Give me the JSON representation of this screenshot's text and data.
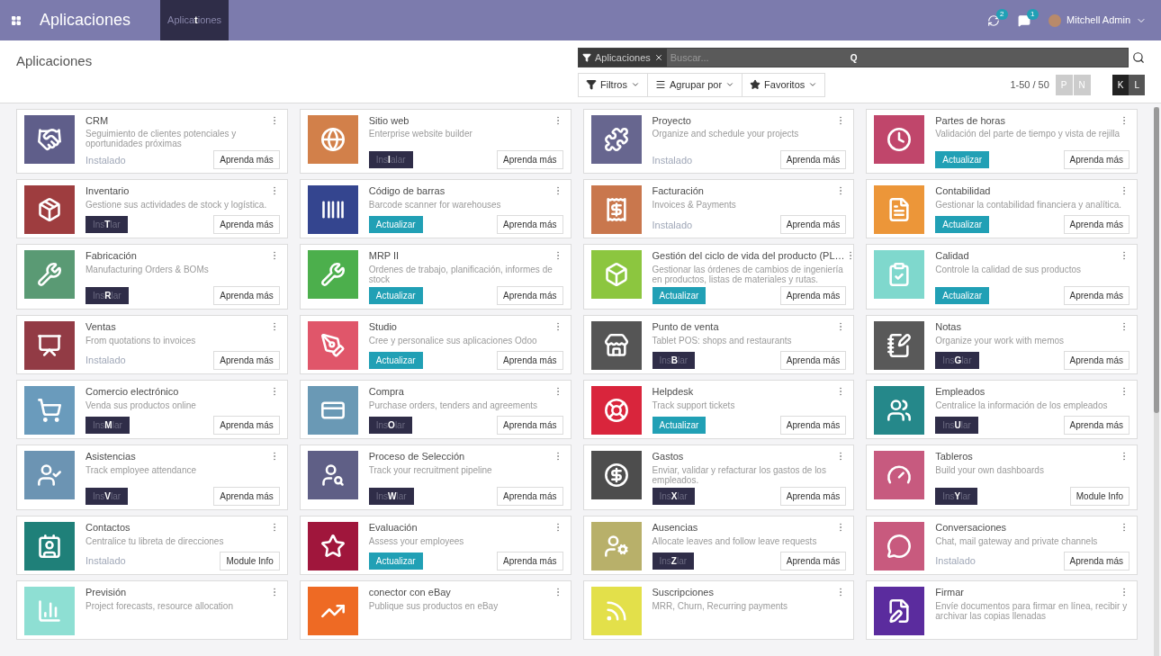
{
  "navbar": {
    "app_title": "Aplicaciones",
    "breadcrumb": {
      "start": "Aplica",
      "hotkey": "t",
      "end": "iones"
    },
    "activity_count": "2",
    "message_count": "1",
    "user": "Mitchell Admin"
  },
  "control_panel": {
    "title": "Aplicaciones",
    "search": {
      "facet": "Aplicaciones",
      "placeholder": "Buscar...",
      "hotkey": "Q"
    },
    "filters": [
      "Filtros",
      "Agrupar por",
      "Favoritos"
    ],
    "pager": "1-50 / 50",
    "pager_buttons": [
      "P",
      "N"
    ],
    "view_buttons": [
      {
        "label": "K",
        "selected": true
      },
      {
        "label": "L",
        "selected": false
      }
    ]
  },
  "apps": [
    {
      "name": "CRM",
      "summary": "Seguimiento de clientes potenciales y oportunidades próximas",
      "color": "#5f5e8a",
      "status": {
        "kind": "installed",
        "text": "Instalado"
      },
      "info": "Aprenda más"
    },
    {
      "name": "Sitio web",
      "summary": "Enterprise website builder",
      "color": "#d2804a",
      "status": {
        "kind": "install",
        "start": "Ins",
        "hotkey": "I",
        "end": "alar"
      },
      "info": "Aprenda más"
    },
    {
      "name": "Proyecto",
      "summary": "Organize and schedule your projects",
      "color": "#67668f",
      "status": {
        "kind": "installed",
        "text": "Instalado"
      },
      "info": "Aprenda más"
    },
    {
      "name": "Partes de horas",
      "summary": "Validación del parte de tiempo y vista de rejilla",
      "color": "#c0466b",
      "status": {
        "kind": "upgrade",
        "text": "Actualizar"
      },
      "info": "Aprenda más"
    },
    {
      "name": "Inventario",
      "summary": "Gestione sus actividades de stock y logística.",
      "color": "#9e3d3f",
      "status": {
        "kind": "install",
        "start": "Ins",
        "hotkey": "T",
        "end": "lar"
      },
      "info": "Aprenda más"
    },
    {
      "name": "Código de barras",
      "summary": "Barcode scanner for warehouses",
      "color": "#34458f",
      "status": {
        "kind": "upgrade",
        "text": "Actualizar"
      },
      "info": "Aprenda más"
    },
    {
      "name": "Facturación",
      "summary": "Invoices & Payments",
      "color": "#c9774d",
      "status": {
        "kind": "installed",
        "text": "Instalado"
      },
      "info": "Aprenda más"
    },
    {
      "name": "Contabilidad",
      "summary": "Gestionar la contabilidad financiera y analítica.",
      "color": "#ec9639",
      "status": {
        "kind": "upgrade",
        "text": "Actualizar"
      },
      "info": "Aprenda más"
    },
    {
      "name": "Fabricación",
      "summary": "Manufacturing Orders & BOMs",
      "color": "#5a9a74",
      "status": {
        "kind": "install",
        "start": "Ins",
        "hotkey": "R",
        "end": "lar"
      },
      "info": "Aprenda más"
    },
    {
      "name": "MRP II",
      "summary": "Ordenes de trabajo, planificación, informes de stock",
      "color": "#4caf4c",
      "status": {
        "kind": "upgrade",
        "text": "Actualizar"
      },
      "info": "Aprenda más"
    },
    {
      "name": "Gestión del ciclo de vida del producto (PL…",
      "summary": "Gestionar las órdenes de cambios de ingeniería en productos, listas de materiales y rutas.",
      "color": "#8cc63f",
      "status": {
        "kind": "upgrade",
        "text": "Actualizar"
      },
      "info": "Aprenda más"
    },
    {
      "name": "Calidad",
      "summary": "Controle la calidad de sus productos",
      "color": "#7fd8cd",
      "status": {
        "kind": "upgrade",
        "text": "Actualizar"
      },
      "info": "Aprenda más"
    },
    {
      "name": "Ventas",
      "summary": "From quotations to invoices",
      "color": "#923b45",
      "status": {
        "kind": "installed",
        "text": "Instalado"
      },
      "info": "Aprenda más"
    },
    {
      "name": "Studio",
      "summary": "Cree y personalice sus aplicaciones Odoo",
      "color": "#e0566a",
      "status": {
        "kind": "upgrade",
        "text": "Actualizar"
      },
      "info": "Aprenda más"
    },
    {
      "name": "Punto de venta",
      "summary": "Tablet POS: shops and restaurants",
      "color": "#555555",
      "status": {
        "kind": "install",
        "start": "Ins",
        "hotkey": "B",
        "end": "lar"
      },
      "info": "Aprenda más"
    },
    {
      "name": "Notas",
      "summary": "Organize your work with memos",
      "color": "#595959",
      "status": {
        "kind": "install",
        "start": "Ins",
        "hotkey": "G",
        "end": "lar"
      },
      "info": "Aprenda más"
    },
    {
      "name": "Comercio electrónico",
      "summary": "Venda sus productos online",
      "color": "#6a9bbc",
      "status": {
        "kind": "install",
        "start": "Ins",
        "hotkey": "M",
        "end": "lar"
      },
      "info": "Aprenda más"
    },
    {
      "name": "Compra",
      "summary": "Purchase orders, tenders and agreements",
      "color": "#6a99b5",
      "status": {
        "kind": "install",
        "start": "Ins",
        "hotkey": "O",
        "end": "lar"
      },
      "info": "Aprenda más"
    },
    {
      "name": "Helpdesk",
      "summary": "Track support tickets",
      "color": "#d9253c",
      "status": {
        "kind": "upgrade",
        "text": "Actualizar"
      },
      "info": "Aprenda más"
    },
    {
      "name": "Empleados",
      "summary": "Centralice la información de los empleados",
      "color": "#25888a",
      "status": {
        "kind": "install",
        "start": "Ins",
        "hotkey": "U",
        "end": "lar"
      },
      "info": "Aprenda más"
    },
    {
      "name": "Asistencias",
      "summary": "Track employee attendance",
      "color": "#6c94b3",
      "status": {
        "kind": "install",
        "start": "Ins",
        "hotkey": "V",
        "end": "lar"
      },
      "info": "Aprenda más"
    },
    {
      "name": "Proceso de Selección",
      "summary": "Track your recruitment pipeline",
      "color": "#5f5f86",
      "status": {
        "kind": "install",
        "start": "Ins",
        "hotkey": "W",
        "end": "lar"
      },
      "info": "Aprenda más"
    },
    {
      "name": "Gastos",
      "summary": "Enviar, validar y refacturar los gastos de los empleados.",
      "color": "#4d4d4d",
      "status": {
        "kind": "install",
        "start": "Ins",
        "hotkey": "X",
        "end": "lar"
      },
      "info": "Aprenda más"
    },
    {
      "name": "Tableros",
      "summary": "Build your own dashboards",
      "color": "#c75a7f",
      "status": {
        "kind": "install",
        "start": "Ins",
        "hotkey": "Y",
        "end": "lar"
      },
      "info": "Module Info"
    },
    {
      "name": "Contactos",
      "summary": "Centralice tu libreta de direcciones",
      "color": "#1f8079",
      "status": {
        "kind": "installed",
        "text": "Instalado"
      },
      "info": "Module Info"
    },
    {
      "name": "Evaluación",
      "summary": "Assess your employees",
      "color": "#a0163c",
      "status": {
        "kind": "upgrade",
        "text": "Actualizar"
      },
      "info": "Aprenda más"
    },
    {
      "name": "Ausencias",
      "summary": "Allocate leaves and follow leave requests",
      "color": "#b8b06a",
      "status": {
        "kind": "install",
        "start": "Ins",
        "hotkey": "Z",
        "end": "lar"
      },
      "info": "Aprenda más"
    },
    {
      "name": "Conversaciones",
      "summary": "Chat, mail gateway and private channels",
      "color": "#c85a7e",
      "status": {
        "kind": "installed",
        "text": "Instalado"
      },
      "info": "Aprenda más"
    },
    {
      "name": "Previsión",
      "summary": "Project forecasts, resource allocation",
      "color": "#8edfd3"
    },
    {
      "name": "conector con eBay",
      "summary": "Publique sus productos en eBay",
      "color": "#ee6a24"
    },
    {
      "name": "Suscripciones",
      "summary": "MRR, Churn, Recurring payments",
      "color": "#e3e04a"
    },
    {
      "name": "Firmar",
      "summary": "Envíe documentos para firmar en línea, recibir y archivar las copias llenadas",
      "color": "#5b2c9e"
    }
  ]
}
